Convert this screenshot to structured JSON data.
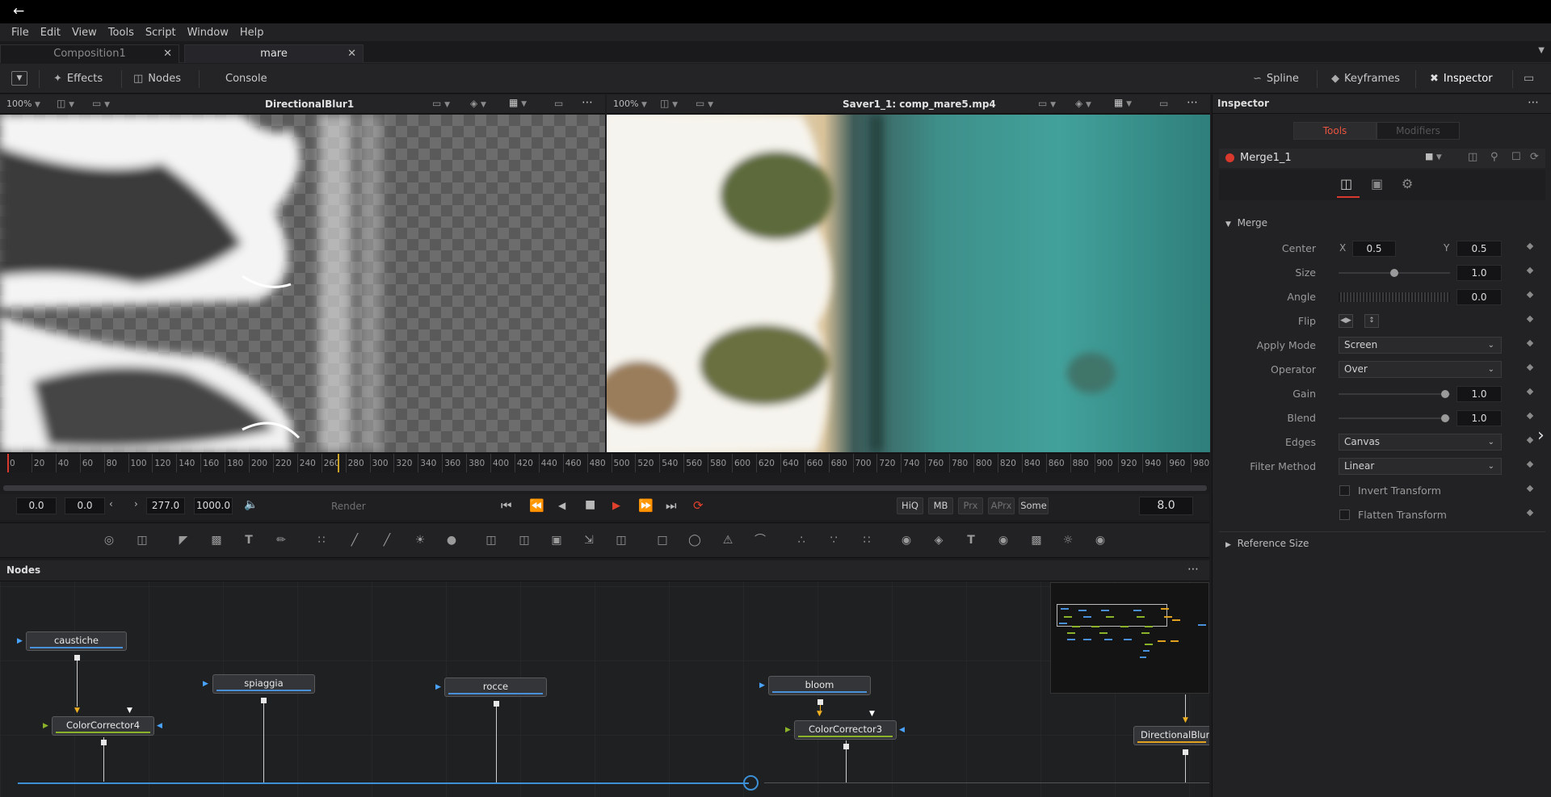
{
  "menu": [
    "File",
    "Edit",
    "View",
    "Tools",
    "Script",
    "Window",
    "Help"
  ],
  "tabs": [
    {
      "label": "Composition1",
      "active": false
    },
    {
      "label": "mare",
      "active": true
    }
  ],
  "toolbar": {
    "effects": "Effects",
    "nodes": "Nodes",
    "console": "Console",
    "spline": "Spline",
    "keyframes": "Keyframes",
    "inspector": "Inspector"
  },
  "viewer_left": {
    "zoom": "100%",
    "title": "DirectionalBlur1"
  },
  "viewer_right": {
    "zoom": "100%",
    "title": "Saver1_1: comp_mare5.mp4"
  },
  "ruler": [
    "0",
    "20",
    "40",
    "60",
    "80",
    "100",
    "120",
    "140",
    "160",
    "180",
    "200",
    "220",
    "240",
    "260",
    "280",
    "300",
    "320",
    "340",
    "360",
    "380",
    "400",
    "420",
    "440",
    "460",
    "480",
    "500",
    "520",
    "540",
    "560",
    "580",
    "600",
    "620",
    "640",
    "660",
    "680",
    "700",
    "720",
    "740",
    "760",
    "780",
    "800",
    "820",
    "840",
    "860",
    "880",
    "900",
    "920",
    "940",
    "960",
    "980"
  ],
  "transport": {
    "start": "0.0",
    "current": "0.0",
    "end": "277.0",
    "global_end": "1000.0",
    "render": "Render",
    "hiq": "HiQ",
    "mb": "MB",
    "prx": "Prx",
    "aprx": "APrx",
    "some": "Some",
    "frame": "8.0"
  },
  "nodes_panel": {
    "title": "Nodes"
  },
  "nodes": {
    "caustiche": "caustiche",
    "spiaggia": "spiaggia",
    "rocce": "rocce",
    "bloom": "bloom",
    "cc4": "ColorCorrector4",
    "cc3": "ColorCorrector3",
    "dblur": "DirectionalBlur"
  },
  "inspector": {
    "title": "Inspector",
    "tab_tools": "Tools",
    "tab_modifiers": "Modifiers",
    "tool_name": "Merge1_1",
    "section": "Merge",
    "center": {
      "label": "Center",
      "x_label": "X",
      "x": "0.5",
      "y_label": "Y",
      "y": "0.5"
    },
    "size": {
      "label": "Size",
      "value": "1.0"
    },
    "angle": {
      "label": "Angle",
      "value": "0.0"
    },
    "flip": {
      "label": "Flip"
    },
    "apply_mode": {
      "label": "Apply Mode",
      "value": "Screen"
    },
    "operator": {
      "label": "Operator",
      "value": "Over"
    },
    "gain": {
      "label": "Gain",
      "value": "1.0"
    },
    "blend": {
      "label": "Blend",
      "value": "1.0"
    },
    "edges": {
      "label": "Edges",
      "value": "Canvas"
    },
    "filter_method": {
      "label": "Filter Method",
      "value": "Linear"
    },
    "invert_transform": "Invert Transform",
    "flatten_transform": "Flatten Transform",
    "reference_size": "Reference Size"
  },
  "colors": {
    "accent_red": "#d9382c",
    "node_blue": "#4a90d9",
    "node_green": "#8ab32a"
  }
}
